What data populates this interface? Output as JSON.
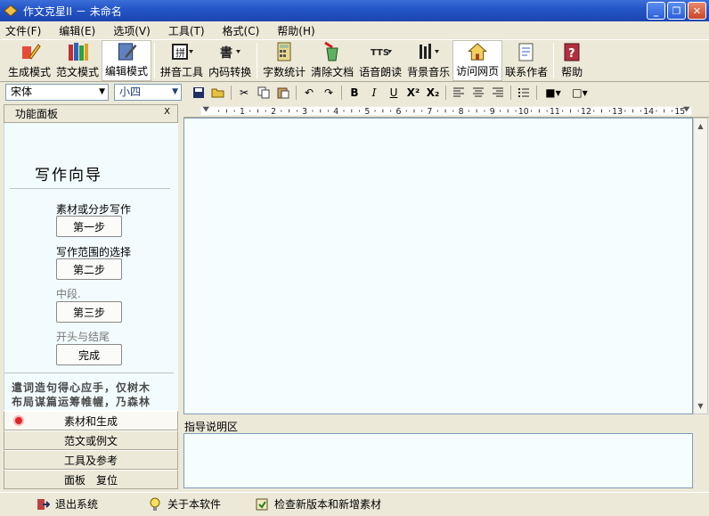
{
  "window": {
    "title": "作文克星II － 未命名"
  },
  "menu": [
    "文件(F)",
    "编辑(E)",
    "选项(V)",
    "工具(T)",
    "格式(C)",
    "帮助(H)"
  ],
  "toolbar": {
    "gen_mode": "生成模式",
    "sample_mode": "范文模式",
    "edit_mode": "编辑模式",
    "pinyin": "拼音工具",
    "code_convert": "内码转换",
    "word_count": "字数统计",
    "clear_doc": "清除文档",
    "read_aloud": "语音朗读",
    "bg_music": "背景音乐",
    "visit_web": "访问网页",
    "contact": "联系作者",
    "help": "帮助"
  },
  "format": {
    "font": "宋体",
    "size": "小四",
    "bold": "B",
    "italic": "I",
    "underline": "U",
    "superscript": "X²",
    "subscript": "X₂"
  },
  "panel": {
    "header": "功能面板",
    "close": "X",
    "wizard_title": "写作向导",
    "steps": [
      {
        "label": "素材或分步写作",
        "button": "第一步"
      },
      {
        "label": "写作范围的选择",
        "button": "第二步"
      },
      {
        "label": "中段.",
        "button": "第三步"
      },
      {
        "label": "开头与结尾",
        "button": "完成"
      }
    ],
    "quote1": "遣词造句得心应手，仅树木",
    "quote2": "布局谋篇运筹帷幄，乃森林",
    "nav": [
      "素材和生成",
      "范文或例文",
      "工具及参考",
      "面板　复位"
    ]
  },
  "ruler": {
    "marks": [
      "1",
      "2",
      "3",
      "4",
      "5",
      "6",
      "7",
      "8",
      "9",
      "10",
      "11",
      "12",
      "13",
      "14",
      "15"
    ]
  },
  "guide": {
    "label": "指导说明区"
  },
  "status": {
    "exit": "退出系统",
    "about": "关于本软件",
    "check_update": "检查新版本和新增素材"
  },
  "colors": {
    "titlebar": "#2456c8",
    "editor_bg": "#f5fdff",
    "panel_bg": "#f2fbfd"
  }
}
